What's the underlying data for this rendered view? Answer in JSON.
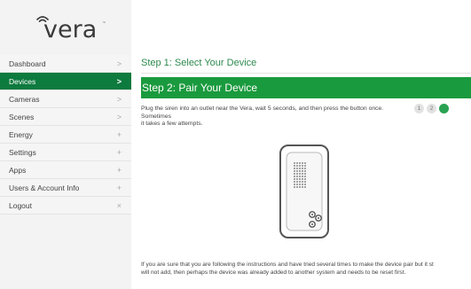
{
  "brand": {
    "logo_text": "vera",
    "trademark": "™"
  },
  "nav": {
    "items": [
      {
        "label": "Dashboard",
        "symbol": ">"
      },
      {
        "label": "Devices",
        "symbol": ">"
      },
      {
        "label": "Cameras",
        "symbol": ">"
      },
      {
        "label": "Scenes",
        "symbol": ">"
      },
      {
        "label": "Energy",
        "symbol": "+"
      },
      {
        "label": "Settings",
        "symbol": "+"
      },
      {
        "label": "Apps",
        "symbol": "+"
      },
      {
        "label": "Users & Account Info",
        "symbol": "+"
      },
      {
        "label": "Logout",
        "symbol": "×"
      }
    ],
    "active_index": 1
  },
  "steps": {
    "step1": "Step 1: Select Your Device",
    "step2": "Step 2: Pair Your Device"
  },
  "instructions": {
    "line1": "Plug the siren into an outlet near the Vera, wait 5 seconds, and then press the button once. Sometimes",
    "line2": "it takes a few attempts."
  },
  "attempts": [
    "1",
    "2",
    ""
  ],
  "footer": {
    "line1": "If you are sure that you are following the instructions and have tried several times to make the device pair but it st",
    "line2": "will not add, then perhaps the device was already added to another system and needs to be reset first."
  },
  "colors": {
    "accent_green": "#1a9a3e",
    "nav_active": "#0d7a3e",
    "step1_text": "#2d8a4e"
  },
  "icons": {
    "logo": "wifi-arc-icon",
    "device": "siren-device-illustration"
  }
}
